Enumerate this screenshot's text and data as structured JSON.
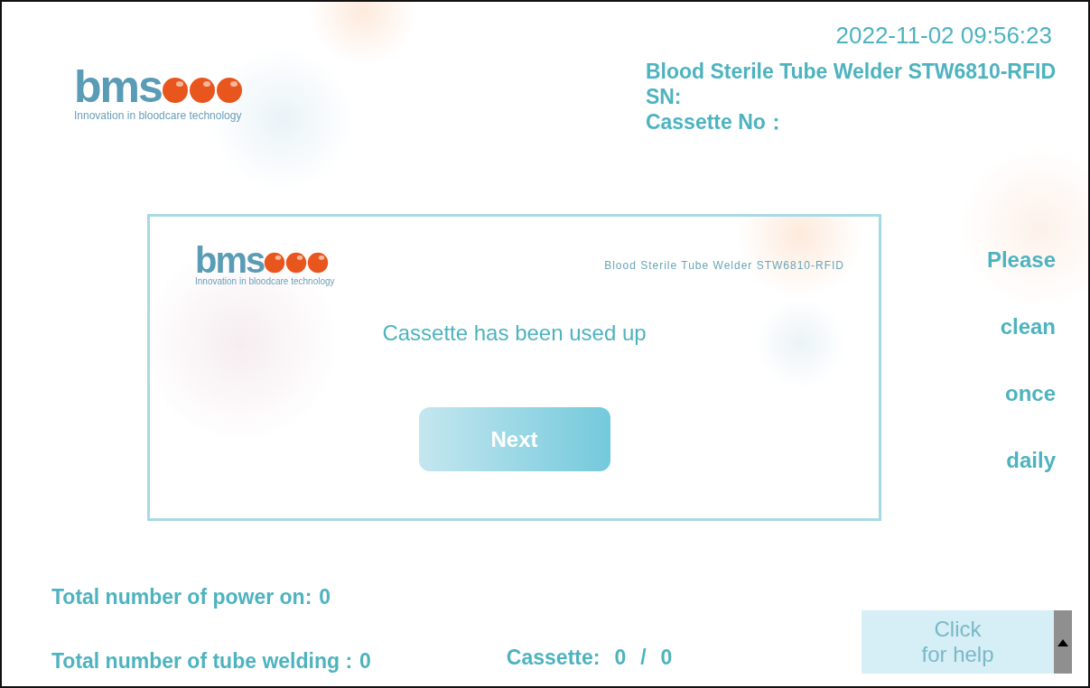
{
  "header": {
    "logo": {
      "wordmark": "bms",
      "tagline": "Innovation in bloodcare technology"
    },
    "datetime": "2022-11-02 09:56:23",
    "device_name": "Blood Sterile Tube Welder STW6810-RFID",
    "sn_label": "SN:",
    "cassette_no_label": "Cassette No："
  },
  "dialog": {
    "logo": {
      "wordmark": "bms",
      "tagline": "Innovation in bloodcare technology"
    },
    "device_name": "Blood Sterile Tube Welder STW6810-RFID",
    "message": "Cassette has been used up",
    "button": "Next"
  },
  "reminder": [
    "Please",
    "clean",
    "once",
    "daily"
  ],
  "stats": [
    {
      "label": "Total number of power on:",
      "value": "0"
    },
    {
      "label": "Total number of tube welding :",
      "value": "0"
    }
  ],
  "cassette": {
    "label": "Cassette:",
    "used": "0",
    "separator": "/",
    "total": "0"
  },
  "help_button": {
    "lines": [
      "Click",
      "for help"
    ]
  }
}
